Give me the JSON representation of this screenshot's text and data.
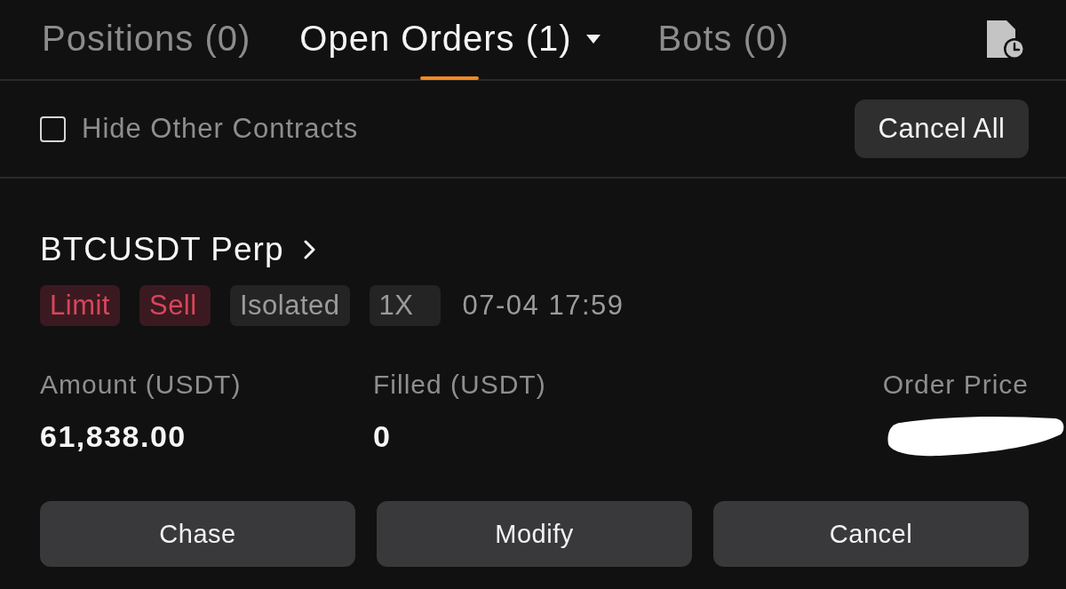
{
  "tabs": [
    {
      "label": "Positions (0)",
      "selected": false,
      "dropdown": false
    },
    {
      "label": "Open Orders (1)",
      "selected": true,
      "dropdown": true
    },
    {
      "label": "Bots (0)",
      "selected": false,
      "dropdown": false
    }
  ],
  "toolbar": {
    "filter": {
      "label": "Hide Other Contracts",
      "checked": false
    },
    "cancel_all": "Cancel All"
  },
  "order": {
    "symbol": "BTCUSDT Perp",
    "tags": [
      {
        "label": "Limit",
        "kind": "alert"
      },
      {
        "label": "Sell",
        "kind": "alert"
      },
      {
        "label": "Isolated",
        "kind": "plain"
      },
      {
        "label": "1X",
        "kind": "plain"
      }
    ],
    "time": "07-04 17:59",
    "fields": [
      {
        "label": "Amount (USDT)",
        "value": "61,838.00",
        "redacted": false
      },
      {
        "label": "Filled (USDT)",
        "value": "0",
        "redacted": false
      },
      {
        "label": "Order Price",
        "redacted": true
      }
    ],
    "actions": [
      "Chase",
      "Modify",
      "Cancel"
    ]
  }
}
